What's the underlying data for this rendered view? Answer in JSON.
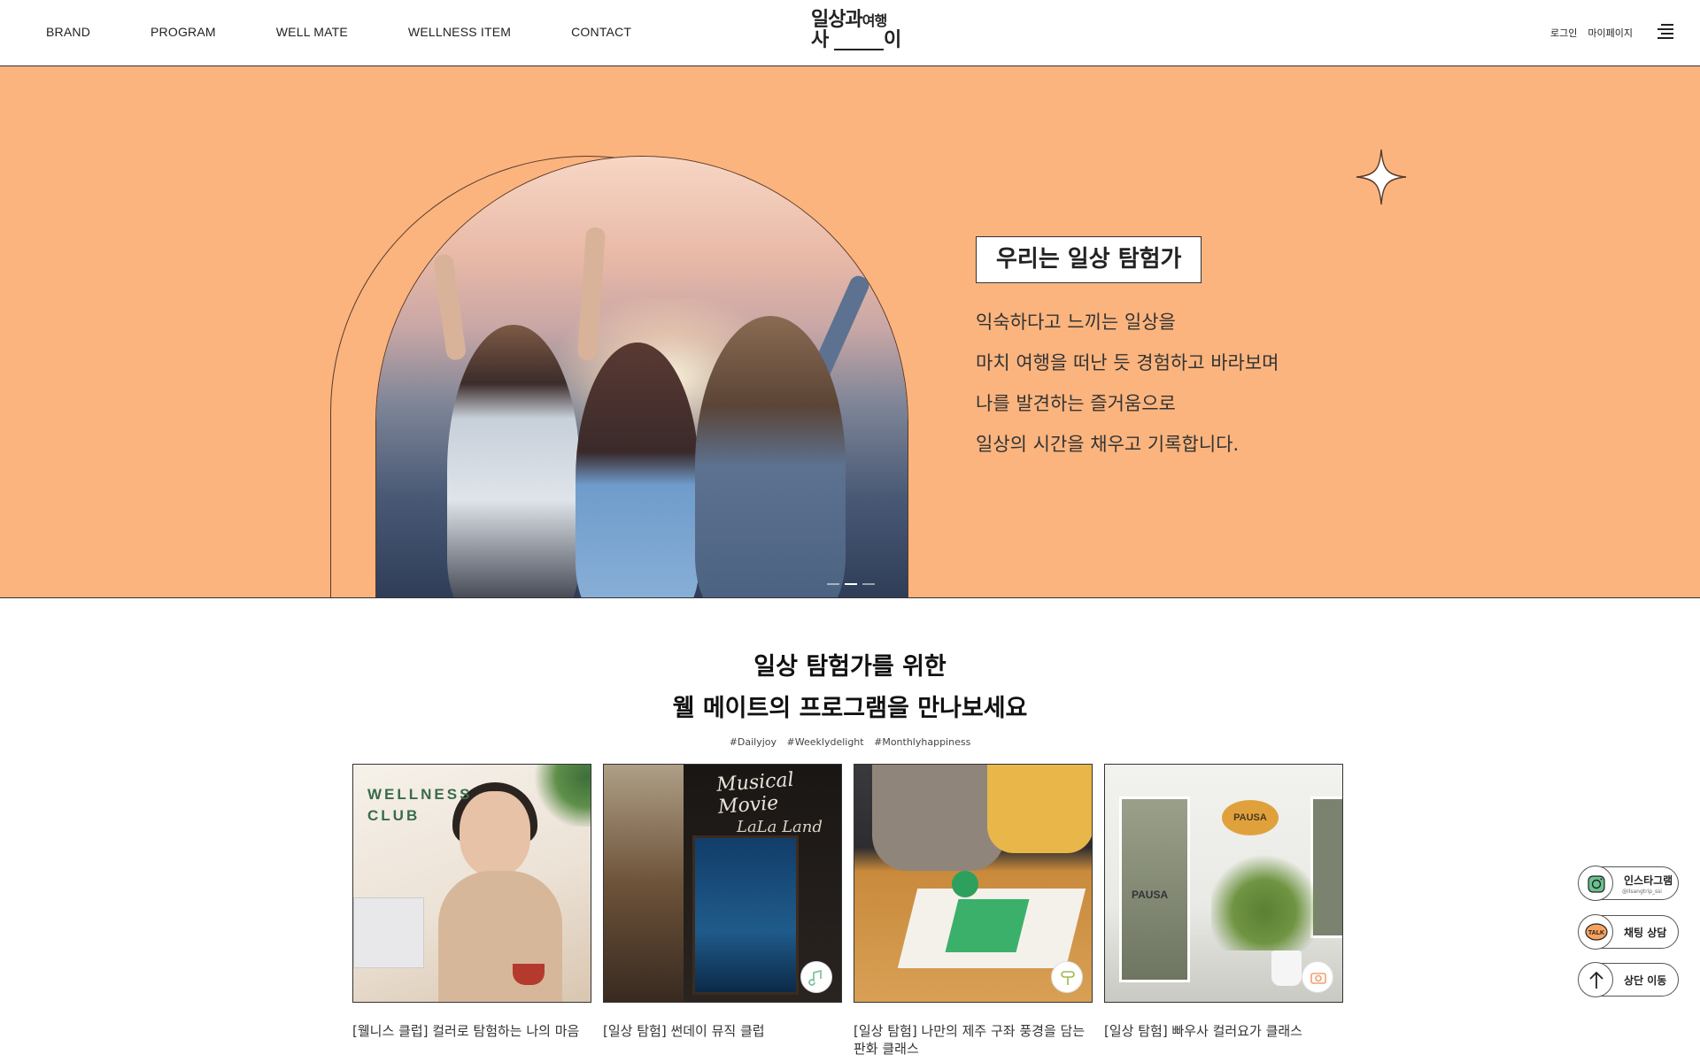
{
  "header": {
    "nav": [
      "BRAND",
      "PROGRAM",
      "WELL MATE",
      "WELLNESS ITEM",
      "CONTACT"
    ],
    "logo": {
      "top": "일상과",
      "top_right": "여행",
      "bottom_left": "사",
      "bottom_right": "이"
    },
    "login": "로그인",
    "mypage": "마이페이지"
  },
  "hero": {
    "title": "우리는 일상 탐험가",
    "lines": [
      "익숙하다고 느끼는 일상을",
      "마치 여행을 떠난 듯 경험하고 바라보며",
      "나를 발견하는 즐거움으로",
      "일상의 시간을 채우고 기록합니다."
    ]
  },
  "program": {
    "title_line1": "일상 탐험가를 위한",
    "title_line2": "웰 메이트의 프로그램을 만나보세요",
    "hashtags": [
      "#Dailyjoy",
      "#Weeklydelight",
      "#Monthlyhappiness"
    ],
    "cards": [
      {
        "title": "[웰니스 클럽] 컬러로 탐험하는 나의 마음",
        "thumb_text": "WELLNESS\nCLUB"
      },
      {
        "title": "[일상 탐험] 썬데이 뮤직 클럽",
        "thumb_text": "Musical Movie",
        "thumb_text2": "LaLa Land"
      },
      {
        "title": "[일상 탐험] 나만의 제주 구좌 풍경을 담는 판화 클래스"
      },
      {
        "title": "[일상 탐험] 빠우사 컬러요가 클래스",
        "thumb_text": "PAUSA"
      }
    ]
  },
  "floating": {
    "instagram": "인스타그램",
    "instagram_handle": "@ilsangtrip_ssi",
    "chat": "채팅 상담",
    "top": "상단 이동"
  },
  "colors": {
    "hero_bg": "#fbb47e",
    "accent_green": "#3a6b4d"
  }
}
